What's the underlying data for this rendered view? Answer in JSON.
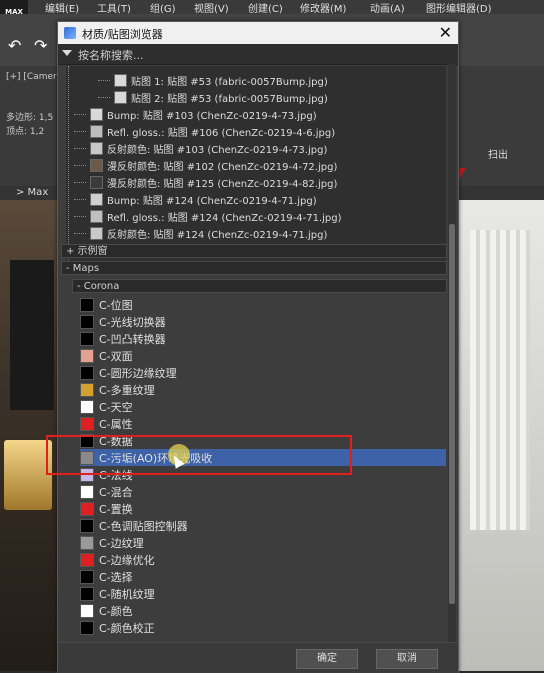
{
  "app": {
    "logo": "MAX",
    "menu": [
      "编辑(E)",
      "工具(T)",
      "组(G)",
      "视图(V)",
      "创建(C)",
      "修改器(M)",
      "动画(A)",
      "图形编辑器(D)"
    ],
    "left_panel": [
      "[+] [Camera",
      "多边形: 1,5",
      "顶点: 1,2"
    ],
    "tab_bar": [
      "> Max"
    ],
    "right_panel": [
      "扫出"
    ]
  },
  "dialog": {
    "title": "材质/贴图浏览器",
    "close_icon": "close-icon",
    "search_placeholder": "按名称搜索...",
    "tree": [
      {
        "swatch": "#d9d9d9",
        "label": "贴图 1: 贴图 #53 (fabric-0057Bump.jpg)"
      },
      {
        "swatch": "#d9d9d9",
        "label": "贴图 2: 贴图 #53 (fabric-0057Bump.jpg)"
      },
      {
        "swatch": "#d9d9d9",
        "label": "Bump: 贴图 #103 (ChenZc-0219-4-73.jpg)"
      },
      {
        "swatch": "#bdbdbd",
        "label": "Refl. gloss.: 贴图 #106 (ChenZc-0219-4-6.jpg)"
      },
      {
        "swatch": "#c8c8c8",
        "label": "反射颜色: 贴图 #103 (ChenZc-0219-4-73.jpg)"
      },
      {
        "swatch": "#6b5a4a",
        "label": "漫反射颜色: 贴图 #102 (ChenZc-0219-4-72.jpg)"
      },
      {
        "swatch": "#3b3b3b",
        "label": "漫反射颜色: 贴图 #125 (ChenZc-0219-4-82.jpg)"
      },
      {
        "swatch": "#d0d0d0",
        "label": "Bump: 贴图 #124 (ChenZc-0219-4-71.jpg)"
      },
      {
        "swatch": "#bfbfbf",
        "label": "Refl. gloss.: 贴图 #124 (ChenZc-0219-4-71.jpg)"
      },
      {
        "swatch": "#c9c9c9",
        "label": "反射颜色: 贴图 #124 (ChenZc-0219-4-71.jpg)"
      }
    ],
    "sections": {
      "examples": "+ 示例窗",
      "maps": "- Maps",
      "corona": "- Corona"
    },
    "maps": [
      {
        "swatch": "#000000",
        "label": "C-位图"
      },
      {
        "swatch": "#000000",
        "label": "C-光线切换器"
      },
      {
        "swatch": "#000000",
        "label": "C-凹凸转换器"
      },
      {
        "swatch": "#e6a090",
        "label": "C-双面"
      },
      {
        "swatch": "#000000",
        "label": "C-圆形边缘纹理"
      },
      {
        "swatch": "#d4a030",
        "label": "C-多重纹理"
      },
      {
        "swatch": "#ffffff",
        "label": "C-天空"
      },
      {
        "swatch": "#e02020",
        "label": "C-属性"
      },
      {
        "swatch": "#000000",
        "label": "C-数据"
      },
      {
        "swatch": "#8a8a8a",
        "label": "C-污垢(AO)环境光吸收"
      },
      {
        "swatch": "#c8b8e8",
        "label": "C-法线"
      },
      {
        "swatch": "#ffffff",
        "label": "C-混合"
      },
      {
        "swatch": "#e02020",
        "label": "C-置换"
      },
      {
        "swatch": "#000000",
        "label": "C-色调贴图控制器"
      },
      {
        "swatch": "#9a9a9a",
        "label": "C-边纹理"
      },
      {
        "swatch": "#e02020",
        "label": "C-边缘优化"
      },
      {
        "swatch": "#000000",
        "label": "C-选择"
      },
      {
        "swatch": "#000000",
        "label": "C-随机纹理"
      },
      {
        "swatch": "#ffffff",
        "label": "C-颜色"
      },
      {
        "swatch": "#000000",
        "label": "C-颜色校正"
      }
    ],
    "selected_index": 9,
    "ok_label": "确定",
    "cancel_label": "取消"
  },
  "colors": {
    "selection": "#3d62a8",
    "highlight_box": "#e01f1f"
  }
}
